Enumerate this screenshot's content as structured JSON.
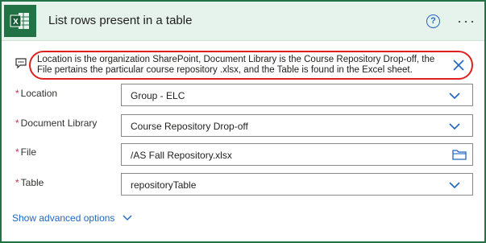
{
  "header": {
    "app_icon_letter": "X",
    "title": "List rows present in a table",
    "help_symbol": "?",
    "more_symbol": "···",
    "accent_color": "#217346"
  },
  "note": {
    "text": "Location is the organization SharePoint, Document Library is the Course Repository Drop-off, the File pertains the particular course repository .xlsx, and the Table is found in the Excel sheet."
  },
  "fields": {
    "location": {
      "required_mark": "*",
      "label": "Location",
      "value": "Group - ELC"
    },
    "document_library": {
      "required_mark": "*",
      "label": "Document Library",
      "value": "Course Repository Drop-off"
    },
    "file": {
      "required_mark": "*",
      "label": "File",
      "value": "/AS Fall Repository.xlsx"
    },
    "table": {
      "required_mark": "*",
      "label": "Table",
      "value": "repositoryTable"
    }
  },
  "advanced": {
    "label": "Show advanced options"
  }
}
